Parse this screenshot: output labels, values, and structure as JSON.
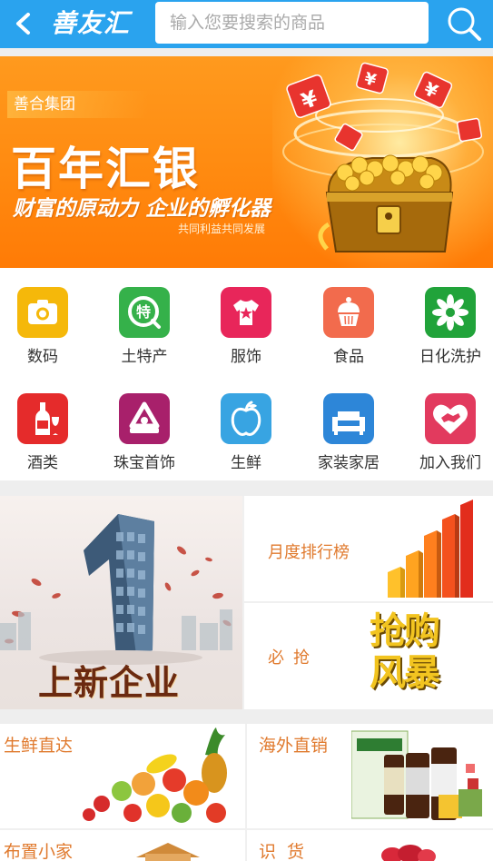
{
  "header": {
    "logo_text": "善友汇",
    "search_placeholder": "输入您要搜索的商品",
    "bar_color": "#2aa3ee"
  },
  "banner": {
    "tag": "善合集团",
    "title": "百年汇银",
    "slogan": "财富的原动力 企业的孵化器",
    "small_text": "共同利益共同发展",
    "background_color": "#ff8a10"
  },
  "categories": [
    {
      "label": "数码",
      "icon": "camera-icon",
      "color": "#f5b80a"
    },
    {
      "label": "土特产",
      "icon": "local-specialty-icon",
      "color": "#35b14a"
    },
    {
      "label": "服饰",
      "icon": "tshirt-icon",
      "color": "#e8265a"
    },
    {
      "label": "食品",
      "icon": "cupcake-icon",
      "color": "#f26b4d"
    },
    {
      "label": "日化洗护",
      "icon": "flower-icon",
      "color": "#21a33a"
    },
    {
      "label": "酒类",
      "icon": "wine-icon",
      "color": "#e52b2b"
    },
    {
      "label": "珠宝首饰",
      "icon": "jewelry-icon",
      "color": "#a8206b"
    },
    {
      "label": "生鲜",
      "icon": "apple-icon",
      "color": "#38a4e2"
    },
    {
      "label": "家装家居",
      "icon": "sofa-icon",
      "color": "#2d86d8"
    },
    {
      "label": "加入我们",
      "icon": "handshake-heart-icon",
      "color": "#e23a5e"
    }
  ],
  "promo": {
    "left_title": "上新企业",
    "right_top_label": "月度排行榜",
    "right_bottom_label": "必抢",
    "right_bottom_badge": "抢购风暴",
    "label_color": "#e07a2e"
  },
  "sections": [
    {
      "label": "生鲜直达"
    },
    {
      "label": "海外直销"
    },
    {
      "label": "布置小家"
    },
    {
      "label": "识货"
    }
  ]
}
